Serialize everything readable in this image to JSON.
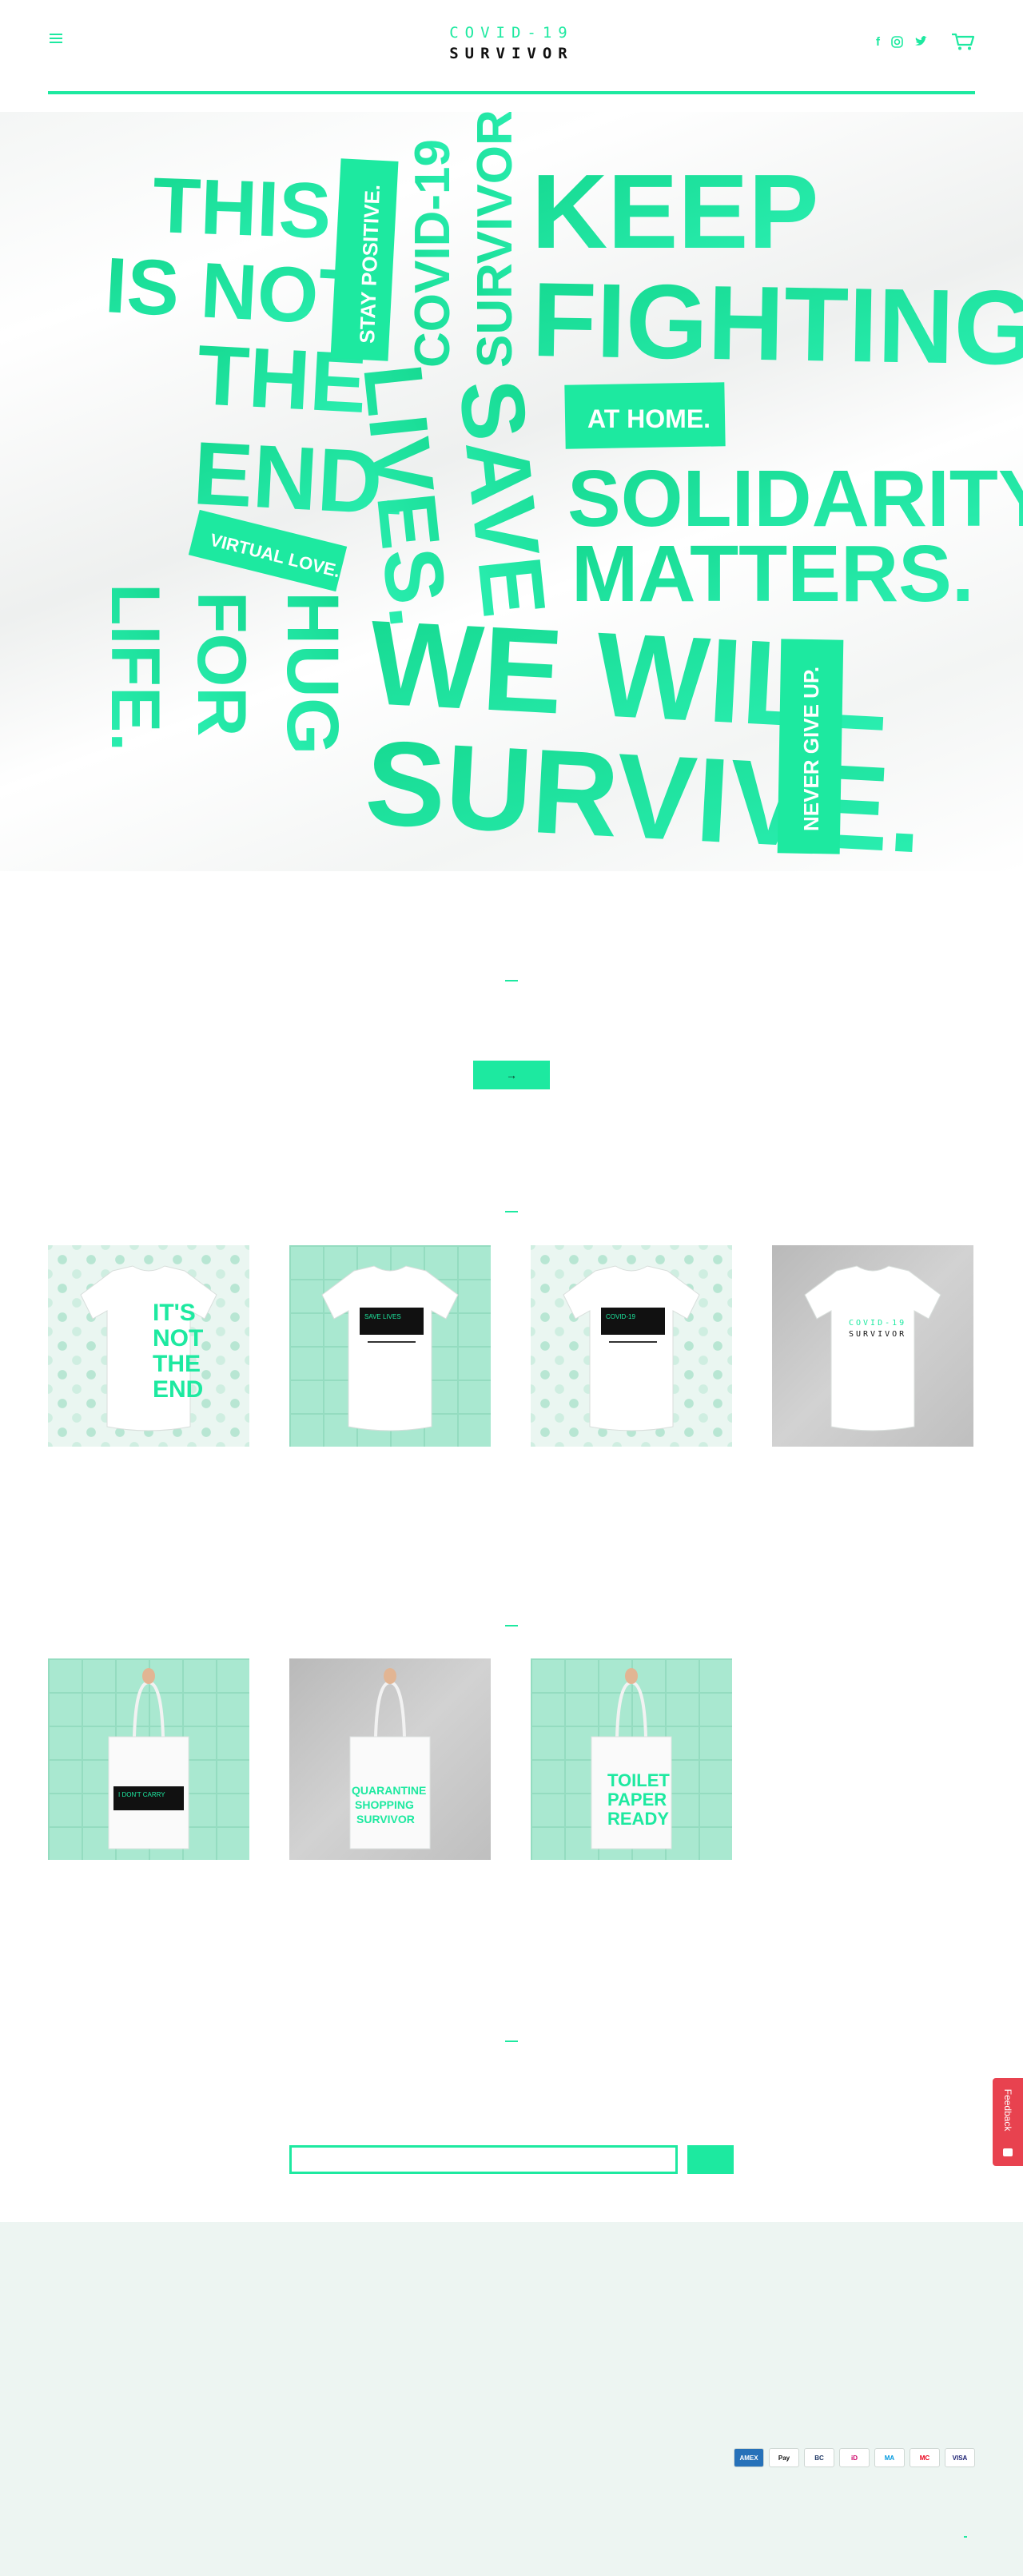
{
  "header": {
    "logo_line1": "COVID-19",
    "logo_line2": "SURVIVOR",
    "menu_icon": "hamburger-icon",
    "social_icons": [
      "facebook-icon",
      "instagram-icon",
      "twitter-icon"
    ],
    "cart_icon": "cart-icon"
  },
  "hero": {
    "words": {
      "this": "THIS",
      "is_not": "IS NOT",
      "the": "THE",
      "end": "END.",
      "stay_positive": "STAY POSITIVE.",
      "covid19": "COVID-19",
      "survivor": "SURVIVOR.",
      "keep": "KEEP",
      "fighting": "FIGHTING.",
      "lives": "LIVES.",
      "save": "SAVE",
      "at_home": "AT HOME.",
      "solidarity": "SOLIDARITY",
      "matters": "MATTERS.",
      "virtual_love": "VIRTUAL LOVE.",
      "life": "LIFE.",
      "for": "FOR",
      "hug": "HUG",
      "we_will": "WE WILL",
      "survive": "SURVIVE.",
      "never_give_up": "NEVER GIVE UP."
    }
  },
  "shop": {
    "arrow": "→",
    "tshirts": [
      {
        "style": "pattern",
        "print": "its-not-the-end",
        "text": [
          "IT'S",
          "NOT",
          "THE",
          "END"
        ]
      },
      {
        "style": "green",
        "print": "save-lives-box",
        "text": [
          "SAVE LIVES"
        ]
      },
      {
        "style": "pattern",
        "print": "covid-box",
        "text": [
          "COVID-19"
        ]
      },
      {
        "style": "grey",
        "print": "logo",
        "text": [
          "COVID-19",
          "SURVIVOR"
        ]
      }
    ],
    "totes": [
      {
        "style": "green",
        "print": "black-box",
        "text": [
          "I DON'T CARRY"
        ]
      },
      {
        "style": "grey",
        "print": "quarantine",
        "text": [
          "QUARANTINE",
          "SHOPPING",
          "SURVIVOR"
        ]
      },
      {
        "style": "green",
        "print": "toilet-paper",
        "text": [
          "TOILET",
          "PAPER",
          "READY"
        ]
      }
    ]
  },
  "newsletter": {
    "email_value": "",
    "submit_icon": "submit-icon"
  },
  "feedback": {
    "label": "Feedback"
  },
  "footer": {
    "payment_icons": [
      "AMEX",
      "Pay",
      "BC",
      "iD",
      "MA",
      "MC",
      "VISA"
    ]
  },
  "colors": {
    "accent": "#1de9a0",
    "footer_bg": "#edf5f2",
    "feedback": "#e8424f"
  }
}
